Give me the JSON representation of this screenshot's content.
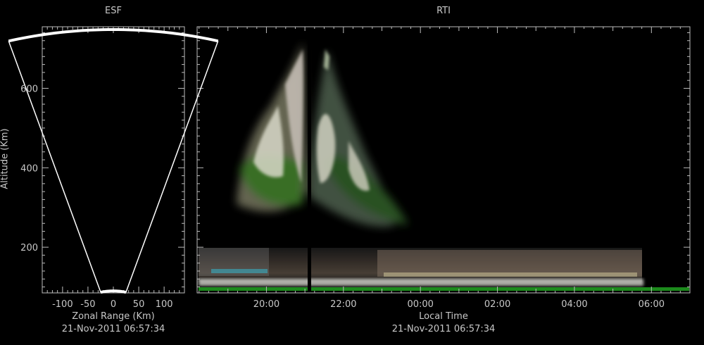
{
  "chart_data": [
    {
      "type": "heatmap",
      "title": "ESF",
      "xlabel": "Zonal Range (Km)",
      "ylabel": "Altitude (Km)",
      "timestamp": "21-Nov-2011 06:57:34",
      "xlim": [
        -140,
        140
      ],
      "ylim": [
        85,
        755
      ],
      "x_ticks": [
        -100,
        -50,
        0,
        50,
        100
      ],
      "y_ticks": [
        200,
        400,
        600
      ],
      "fan": {
        "half_angle_deg": 16,
        "inner_altitude": 90,
        "outer_altitude": 748
      }
    },
    {
      "type": "heatmap",
      "title": "RTI",
      "xlabel": "Local Time",
      "ylabel": "Altitude (Km)",
      "timestamp": "21-Nov-2011 06:57:34",
      "x_ticks": [
        "20:00",
        "22:00",
        "00:00",
        "02:00",
        "04:00",
        "06:00"
      ],
      "x_tick_hours": [
        20,
        22,
        24,
        26,
        28,
        30
      ],
      "xlim_hours": [
        18.2,
        31.0
      ],
      "ylim": [
        85,
        755
      ],
      "y_ticks": [
        200,
        400,
        600
      ],
      "data_gap_hour": 21.05
    }
  ]
}
